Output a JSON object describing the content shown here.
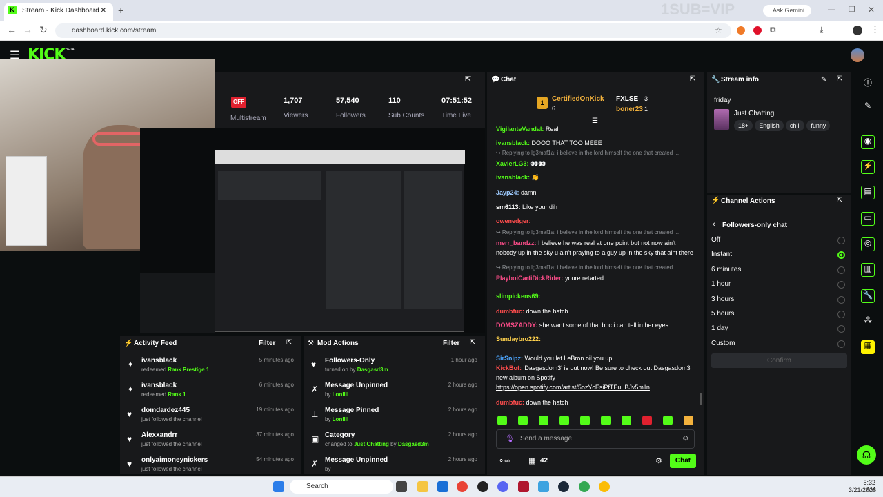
{
  "browser": {
    "tab_title": "Stream - Kick Dashboard",
    "url": "dashboard.kick.com/stream",
    "overlay_text": "1SUB=VIP",
    "ask_gemini": "Ask Gemini"
  },
  "kick": {
    "logo": "KICK",
    "beta": "BETA"
  },
  "stats": {
    "offline_badge": "OFF",
    "items": [
      {
        "value": "",
        "label": "Multistream"
      },
      {
        "value": "1,707",
        "label": "Viewers"
      },
      {
        "value": "57,540",
        "label": "Followers"
      },
      {
        "value": "110",
        "label": "Sub Counts"
      },
      {
        "value": "07:51:52",
        "label": "Time Live"
      }
    ]
  },
  "activity_feed": {
    "title": "Activity Feed",
    "filter": "Filter",
    "items": [
      {
        "user": "ivansblack",
        "pre": "redeemed ",
        "highlight": "Rank Prestige 1",
        "post": "",
        "time": "5 minutes ago",
        "icon": "gift-icon"
      },
      {
        "user": "ivansblack",
        "pre": "redeemed ",
        "highlight": "Rank 1",
        "post": "",
        "time": "6 minutes ago",
        "icon": "gift-icon"
      },
      {
        "user": "domdardez445",
        "pre": "just followed the channel",
        "highlight": "",
        "post": "",
        "time": "19 minutes ago",
        "icon": "heart-icon"
      },
      {
        "user": "Alexxandrr",
        "pre": "just followed the channel",
        "highlight": "",
        "post": "",
        "time": "37 minutes ago",
        "icon": "heart-icon"
      },
      {
        "user": "onlyaimoneynickers",
        "pre": "just followed the channel",
        "highlight": "",
        "post": "",
        "time": "54 minutes ago",
        "icon": "heart-icon"
      }
    ]
  },
  "mod_actions": {
    "title": "Mod Actions",
    "filter": "Filter",
    "items": [
      {
        "title": "Followers-Only",
        "pre": "turned on by ",
        "by": "Dasgasd3m",
        "time": "1 hour ago",
        "icon": "heart-icon"
      },
      {
        "title": "Message Unpinned",
        "pre": "by ",
        "by": "Lonllll",
        "time": "2 hours ago",
        "icon": "unpin-icon"
      },
      {
        "title": "Message Pinned",
        "pre": "by ",
        "by": "Lonllll",
        "time": "2 hours ago",
        "icon": "pin-icon"
      },
      {
        "title": "Category",
        "pre": "changed to ",
        "by": "Just Chatting",
        "extra": " by ",
        "extra_user": "Dasgasd3m",
        "time": "2 hours ago",
        "icon": "category-icon"
      },
      {
        "title": "Message Unpinned",
        "pre": "by ",
        "by": "",
        "time": "2 hours ago",
        "icon": "unpin-icon"
      }
    ]
  },
  "chat": {
    "title": "Chat",
    "top_gifters": [
      {
        "name": "CertifiedOnKick",
        "count": "6",
        "rank": "1"
      },
      {
        "name": "FXLSE",
        "count": "3"
      },
      {
        "name": "boner23",
        "count": "1"
      }
    ],
    "messages": [
      {
        "user": "VigilanteVandal",
        "color": "#53fc18",
        "text": "Real"
      },
      {
        "user": "ivansblack",
        "color": "#53fc18",
        "text": "DOOO THAT TOO MEEE"
      },
      {
        "reply": "Replying to lg3maf1a: i believe in the lord himself the one that created ...",
        "user": "XavierLG3",
        "color": "#53fc18",
        "text": "👀👀"
      },
      {
        "user": "ivansblack",
        "color": "#53fc18",
        "text": "👏"
      },
      {
        "user": "Jayp24",
        "color": "#9ecbff",
        "text": "damn"
      },
      {
        "user": "sm6113",
        "color": "#ffffff",
        "text": "Like your dih"
      },
      {
        "user": "owenedger",
        "color": "#ff4d4d",
        "text": ""
      },
      {
        "reply": "Replying to lg3maf1a: i believe in the lord himself the one that created ...",
        "user": "merr_bandzz",
        "color": "#ff4d8a",
        "text": "I believe he was real at one point but not now ain't nobody up in the sky u ain't praying to a guy up in the sky that aint there"
      },
      {
        "reply": "Replying to lg3maf1a: i believe in the lord himself the one that created ...",
        "user": "PlayboiCartiDickRider",
        "color": "#ff4d8a",
        "text": "youre retarted"
      },
      {
        "user": "slimpickens69",
        "color": "#53fc18",
        "text": ""
      },
      {
        "user": "dumbfuc",
        "color": "#ff4d4d",
        "text": "down the hatch"
      },
      {
        "user": "DOMSZADDY",
        "color": "#ff4d8a",
        "text": "she want some of that bbc i can tell in her eyes"
      },
      {
        "user": "Sundaybro222",
        "color": "#ffd24d",
        "text": ""
      },
      {
        "user": "SirSnipz",
        "color": "#4da6ff",
        "text": "Would you let LeBron oil you up"
      },
      {
        "user": "KickBot",
        "color": "#ff4d4d",
        "text": "'Dasgasdom3' is out now! Be sure to check out Dasgasdom3 new album on Spotify"
      },
      {
        "user": "",
        "color": "#ffffff",
        "text": "https://open.spotify.com/artist/5ozYcEsiPfTEuLBJv5mlln"
      },
      {
        "user": "dumbfuc",
        "color": "#ff4d4d",
        "text": "down the hatch"
      }
    ],
    "input_placeholder": "Send a message",
    "viewer_count": "42",
    "chat_button": "Chat"
  },
  "stream_info": {
    "title": "Stream info",
    "stream_title": "friday",
    "category": "Just Chatting",
    "tags": [
      "18+",
      "English",
      "chill",
      "funny"
    ]
  },
  "channel_actions": {
    "title": "Channel Actions",
    "sub_title": "Followers-only chat",
    "options": [
      {
        "label": "Off",
        "selected": false
      },
      {
        "label": "Instant",
        "selected": true
      },
      {
        "label": "6 minutes",
        "selected": false
      },
      {
        "label": "1 hour",
        "selected": false
      },
      {
        "label": "3 hours",
        "selected": false
      },
      {
        "label": "5 hours",
        "selected": false
      },
      {
        "label": "1 day",
        "selected": false
      },
      {
        "label": "Custom",
        "selected": false
      }
    ],
    "confirm": "Confirm"
  },
  "taskbar": {
    "search": "Search",
    "time": "5:32 AM",
    "date": "3/21/2026"
  }
}
